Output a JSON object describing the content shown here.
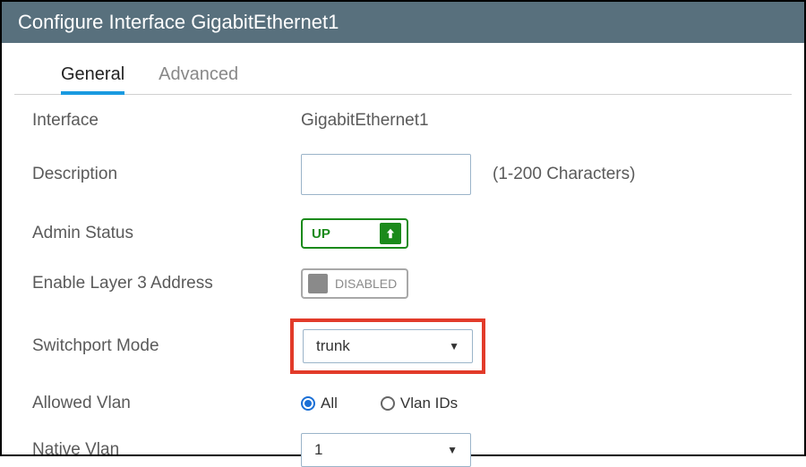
{
  "header": {
    "title": "Configure Interface GigabitEthernet1"
  },
  "tabs": {
    "general": "General",
    "advanced": "Advanced"
  },
  "form": {
    "interface": {
      "label": "Interface",
      "value": "GigabitEthernet1"
    },
    "description": {
      "label": "Description",
      "value": "",
      "hint": "(1-200 Characters)"
    },
    "adminStatus": {
      "label": "Admin Status",
      "value": "UP"
    },
    "layer3": {
      "label": "Enable Layer 3 Address",
      "value": "DISABLED"
    },
    "switchportMode": {
      "label": "Switchport Mode",
      "value": "trunk"
    },
    "allowedVlan": {
      "label": "Allowed Vlan",
      "options": {
        "all": "All",
        "ids": "Vlan IDs"
      },
      "selected": "all"
    },
    "nativeVlan": {
      "label": "Native Vlan",
      "value": "1"
    }
  }
}
